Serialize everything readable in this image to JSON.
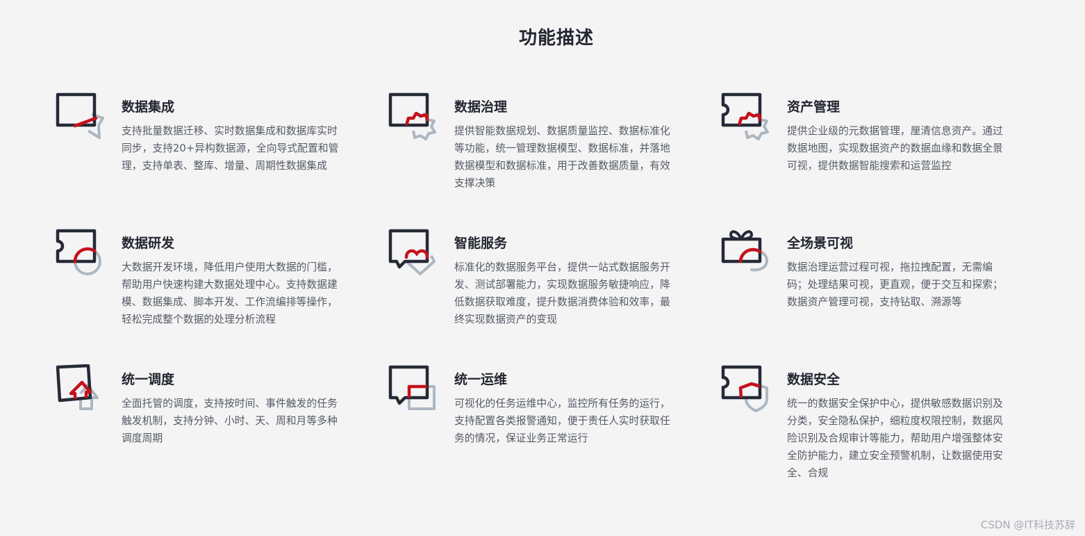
{
  "page": {
    "title": "功能描述"
  },
  "features": [
    {
      "icon": "data-integration-icon",
      "title": "数据集成",
      "description": "支持批量数据迁移、实时数据集成和数据库实时同步，支持20+异构数据源，全向导式配置和管理，支持单表、整库、增量、周期性数据集成"
    },
    {
      "icon": "data-governance-icon",
      "title": "数据治理",
      "description": "提供智能数据规划、数据质量监控、数据标准化等功能，统一管理数据模型、数据标准，并落地数据模型和数据标准，用于改善数据质量，有效支撑决策"
    },
    {
      "icon": "asset-management-icon",
      "title": "资产管理",
      "description": "提供企业级的元数据管理，厘清信息资产。通过数据地图，实现数据资产的数据血缘和数据全景可视，提供数据智能搜索和运营监控"
    },
    {
      "icon": "data-development-icon",
      "title": "数据研发",
      "description": "大数据开发环境，降低用户使用大数据的门槛，帮助用户快速构建大数据处理中心。支持数据建模、数据集成、脚本开发、工作流编排等操作，轻松完成整个数据的处理分析流程"
    },
    {
      "icon": "smart-service-icon",
      "title": "智能服务",
      "description": "标准化的数据服务平台，提供一站式数据服务开发、测试部署能力，实现数据服务敏捷响应，降低数据获取难度，提升数据消费体验和效率，最终实现数据资产的变现"
    },
    {
      "icon": "full-scene-visual-icon",
      "title": "全场景可视",
      "description": "数据治理运营过程可视，拖拉拽配置，无需编码；处理结果可视，更直观，便于交互和探索；数据资产管理可视，支持钻取、溯源等"
    },
    {
      "icon": "unified-scheduling-icon",
      "title": "统一调度",
      "description": "全面托管的调度，支持按时间、事件触发的任务触发机制，支持分钟、小时、天、周和月等多种调度周期"
    },
    {
      "icon": "unified-ops-icon",
      "title": "统一运维",
      "description": "可视化的任务运维中心，监控所有任务的运行，支持配置各类报警通知，便于责任人实时获取任务的情况，保证业务正常运行"
    },
    {
      "icon": "data-security-icon",
      "title": "数据安全",
      "description": "统一的数据安全保护中心，提供敏感数据识别及分类，安全隐私保护，细粒度权限控制，数据风险识别及合规审计等能力，帮助用户增强整体安全防护能力，建立安全预警机制，让数据使用安全、合规"
    }
  ],
  "watermark": "CSDN @IT科技苏辞",
  "colors": {
    "background": "#f4f4f5",
    "icon_dark": "#262a36",
    "icon_accent": "#c4111b",
    "icon_secondary": "#adb7c2"
  }
}
